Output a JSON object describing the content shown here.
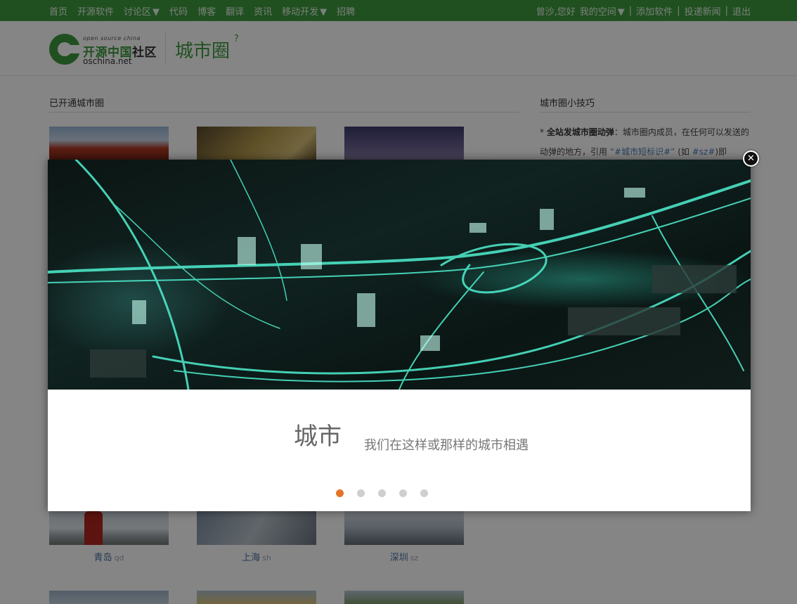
{
  "topnav": {
    "items": [
      {
        "label": "首页"
      },
      {
        "label": "开源软件"
      },
      {
        "label": "讨论区",
        "dropdown": true
      },
      {
        "label": "代码"
      },
      {
        "label": "博客"
      },
      {
        "label": "翻译"
      },
      {
        "label": "资讯"
      },
      {
        "label": "移动开发",
        "dropdown": true
      },
      {
        "label": "招聘"
      }
    ],
    "user_greeting": "曾沙,您好",
    "my_space": "我的空间",
    "sep": "|",
    "add_software": "添加软件",
    "submit_news": "投递新闻",
    "logout": "退出"
  },
  "header": {
    "logo_os": "open source china",
    "logo_cn_green": "开源中国",
    "logo_cn_dark": "社区",
    "logo_net": "oschina.net",
    "page_title": "城市圈",
    "help_mark": "?"
  },
  "main": {
    "section_title": "已开通城市圈",
    "cities": [
      {
        "name": "青岛",
        "abbr": "qd"
      },
      {
        "name": "上海",
        "abbr": "sh"
      },
      {
        "name": "深圳",
        "abbr": "sz"
      }
    ]
  },
  "sidebar": {
    "title": "城市圈小技巧",
    "tip_bullet": "*",
    "tip_bold": "全站发城市圈动弹",
    "tip_text_1": "：城市圈内成员，在任何可以发送的动弹的地方，引用",
    "tip_hashtag": "“#城市短标识#”",
    "tip_text_2": "(如",
    "tip_example": "#sz#",
    "tip_text_3": ")即"
  },
  "modal": {
    "caption_title": "城市",
    "caption_subtitle": "我们在这样或那样的城市相遇",
    "close_label": "✕",
    "slides": 5,
    "active_slide": 1,
    "colors": {
      "accent": "#e3742a",
      "dot": "#cfcfcf",
      "brand_green": "#3f9a3f"
    }
  }
}
